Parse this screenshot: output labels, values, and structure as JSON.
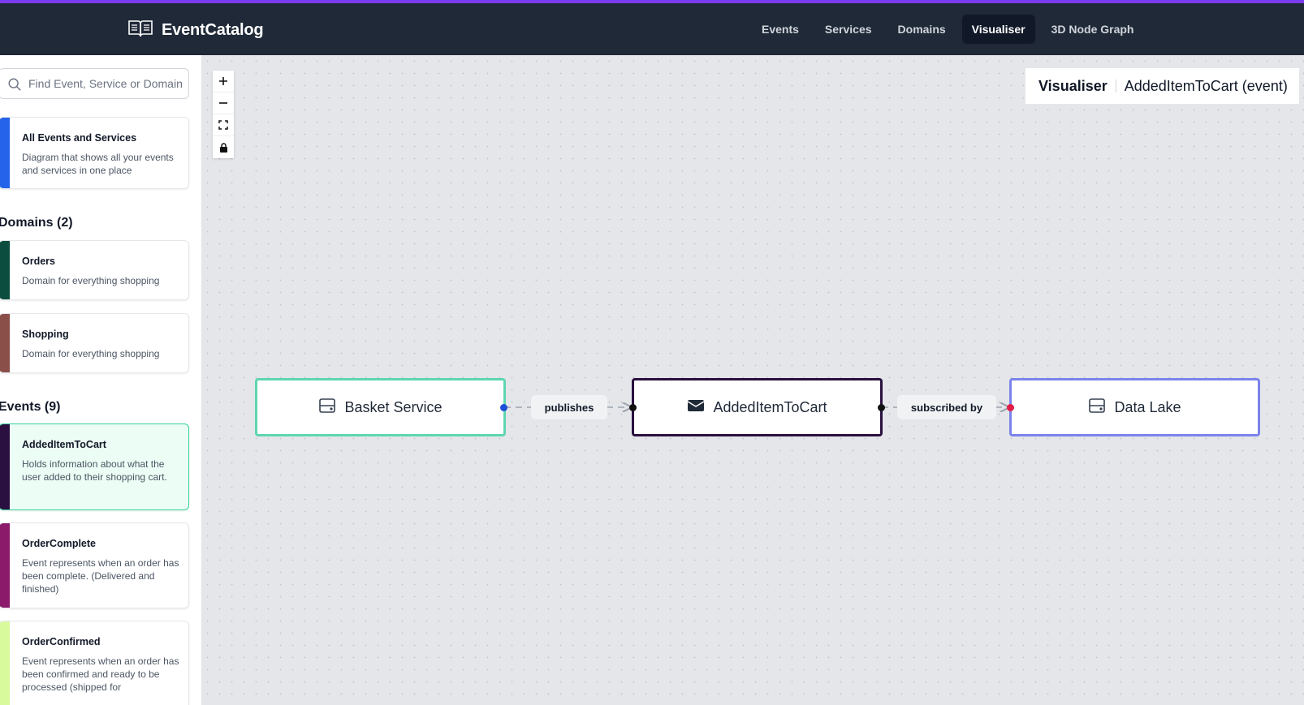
{
  "app": {
    "name": "EventCatalog"
  },
  "nav": {
    "links": [
      {
        "label": "Events"
      },
      {
        "label": "Services"
      },
      {
        "label": "Domains"
      },
      {
        "label": "Visualiser"
      },
      {
        "label": "3D Node Graph"
      }
    ],
    "active": "Visualiser"
  },
  "sidebar": {
    "search_placeholder": "Find Event, Service or Domain",
    "all": {
      "title": "All Events and Services",
      "desc": "Diagram that shows all your events and services in one place",
      "color": "#2563eb"
    },
    "domains_heading": "Domains (2)",
    "domains": [
      {
        "title": "Orders",
        "desc": "Domain for everything shopping",
        "color": "#0b4d3e"
      },
      {
        "title": "Shopping",
        "desc": "Domain for everything shopping",
        "color": "#8b4f4a"
      }
    ],
    "events_heading": "Events (9)",
    "events": [
      {
        "title": "AddedItemToCart",
        "desc": "Holds information about what the user added to their shopping cart.",
        "color": "#2a1040"
      },
      {
        "title": "OrderComplete",
        "desc": "Event represents when an order has been complete. (Delivered and finished)",
        "color": "#8b1a6b"
      },
      {
        "title": "OrderConfirmed",
        "desc": "Event represents when an order has been confirmed and ready to be processed (shipped for",
        "color": "#d9f99d"
      }
    ]
  },
  "panel": {
    "title": "Visualiser",
    "subtitle": "AddedItemToCart (event)"
  },
  "graph": {
    "nodes": [
      {
        "label": "Basket Service",
        "border": "#5ed6b0",
        "icon": "server-icon"
      },
      {
        "label": "AddedItemToCart",
        "border": "#2a1040",
        "icon": "envelope-icon"
      },
      {
        "label": "Data Lake",
        "border": "#7b83eb",
        "icon": "server-icon"
      }
    ],
    "edges": [
      {
        "label": "publishes"
      },
      {
        "label": "subscribed by"
      }
    ]
  }
}
